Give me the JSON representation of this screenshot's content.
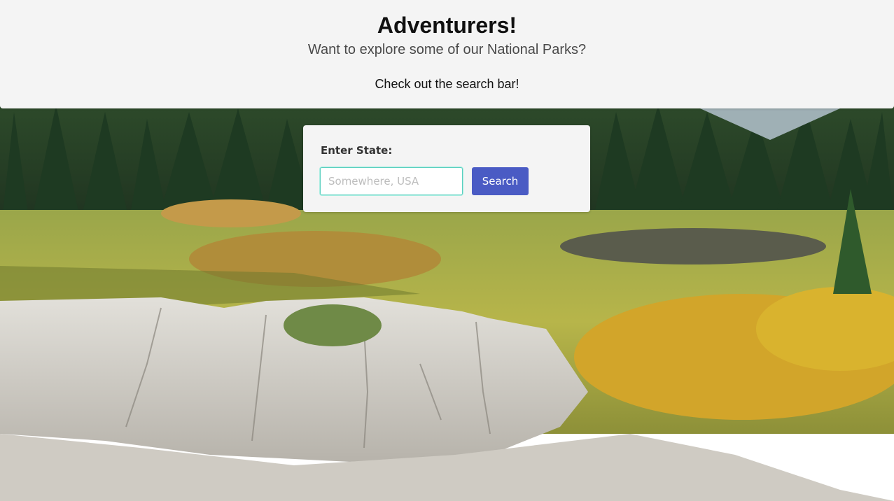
{
  "hero": {
    "title": "Adventurers!",
    "subtitle": "Want to explore some of our National Parks?",
    "cta": "Check out the search bar!"
  },
  "search": {
    "label": "Enter State:",
    "placeholder": "Somewhere, USA",
    "value": "",
    "button_label": "Search"
  },
  "background": {
    "image": "landscape-photo"
  }
}
